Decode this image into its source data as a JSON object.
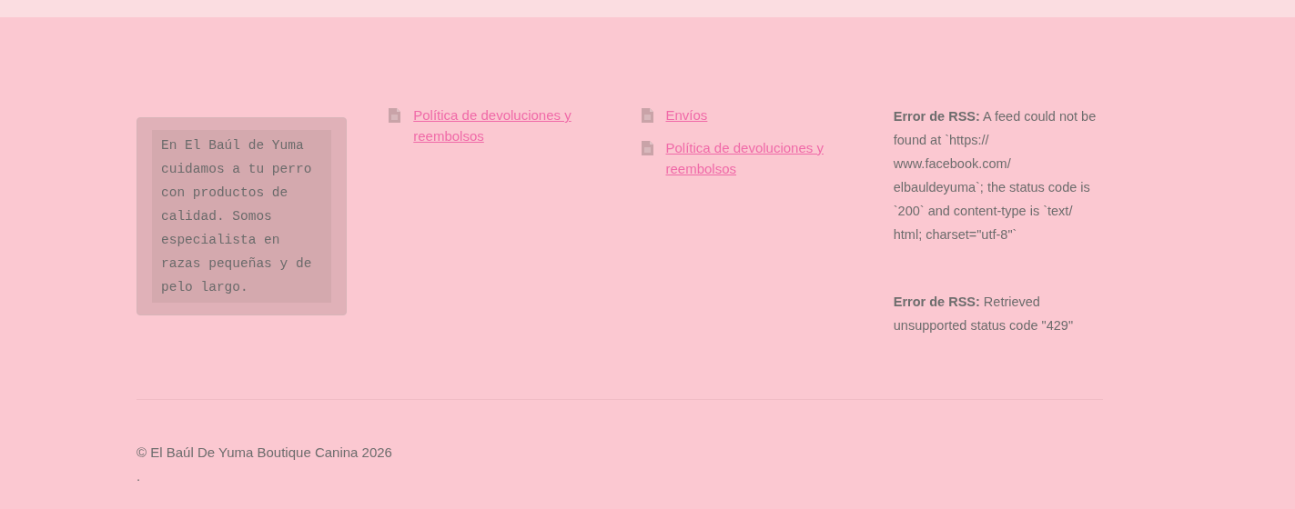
{
  "about": {
    "text": "En El Baúl de Yuma cuidamos a tu perro con productos de calidad. Somos especialista en razas pequeñas y de pelo largo."
  },
  "link_columns": [
    {
      "links": [
        "Política de devoluciones y reembolsos"
      ]
    },
    {
      "links": [
        "Envíos",
        "Política de devoluciones y reembolsos"
      ]
    }
  ],
  "rss_errors": [
    "**Error de RSS:** A feed could not be found at `https:// www.facebook.com/ elbauldeyuma`; the status code is `200` and content-type is `text/ html; charset=\"utf-8\"`",
    "**Error de RSS:** Retrieved unsupported status code \"429\""
  ],
  "copyright": "© El Baúl De Yuma Boutique Canina 2026",
  "footnote": "."
}
